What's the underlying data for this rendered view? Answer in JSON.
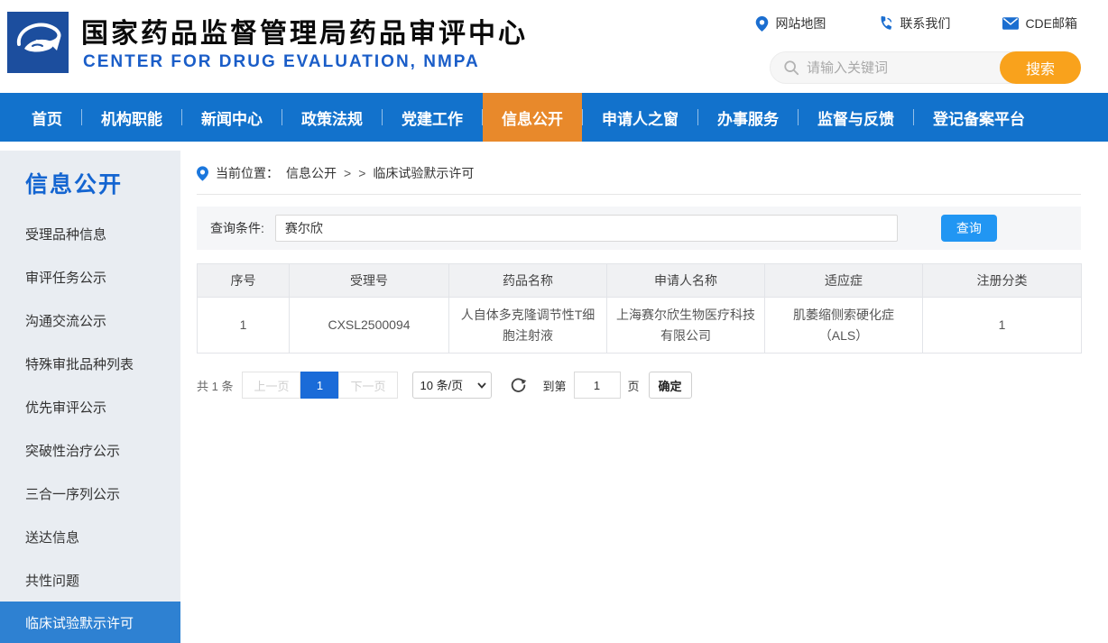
{
  "header": {
    "title": "国家药品监督管理局药品审评中心",
    "subtitle": "CENTER FOR DRUG EVALUATION, NMPA",
    "quick_links": [
      {
        "label": "网站地图",
        "icon": "location-pin-icon"
      },
      {
        "label": "联系我们",
        "icon": "phone-icon"
      },
      {
        "label": "CDE邮箱",
        "icon": "envelope-icon"
      }
    ],
    "search": {
      "placeholder": "请输入关键词",
      "button_label": "搜索"
    }
  },
  "nav": {
    "items": [
      {
        "label": "首页",
        "active": false
      },
      {
        "label": "机构职能",
        "active": false
      },
      {
        "label": "新闻中心",
        "active": false
      },
      {
        "label": "政策法规",
        "active": false
      },
      {
        "label": "党建工作",
        "active": false
      },
      {
        "label": "信息公开",
        "active": true
      },
      {
        "label": "申请人之窗",
        "active": false
      },
      {
        "label": "办事服务",
        "active": false
      },
      {
        "label": "监督与反馈",
        "active": false
      },
      {
        "label": "登记备案平台",
        "active": false
      }
    ]
  },
  "sidebar": {
    "title": "信息公开",
    "items": [
      {
        "label": "受理品种信息",
        "active": false
      },
      {
        "label": "审评任务公示",
        "active": false
      },
      {
        "label": "沟通交流公示",
        "active": false
      },
      {
        "label": "特殊审批品种列表",
        "active": false
      },
      {
        "label": "优先审评公示",
        "active": false
      },
      {
        "label": "突破性治疗公示",
        "active": false
      },
      {
        "label": "三合一序列公示",
        "active": false
      },
      {
        "label": "送达信息",
        "active": false
      },
      {
        "label": "共性问题",
        "active": false
      },
      {
        "label": "临床试验默示许可",
        "active": true
      }
    ]
  },
  "breadcrumb": {
    "prefix": "当前位置：",
    "section": "信息公开",
    "separator": ">",
    "current": "临床试验默示许可"
  },
  "query": {
    "label": "查询条件:",
    "value": "赛尔欣",
    "button_label": "查询"
  },
  "table": {
    "headers": [
      "序号",
      "受理号",
      "药品名称",
      "申请人名称",
      "适应症",
      "注册分类"
    ],
    "rows": [
      [
        "1",
        "CXSL2500094",
        "人自体多克隆调节性T细胞注射液",
        "上海赛尔欣生物医疗科技有限公司",
        "肌萎缩侧索硬化症（ALS）",
        "1"
      ]
    ]
  },
  "pagination": {
    "total": "共 1 条",
    "prev_label": "上一页",
    "current_page": "1",
    "next_label": "下一页",
    "page_size": "10 条/页",
    "goto_label": "到第",
    "goto_value": "1",
    "page_unit": "页",
    "confirm_label": "确定"
  },
  "colors": {
    "nav_blue": "#1272cc",
    "nav_active_orange": "#e8892b",
    "search_orange": "#f9a21c",
    "query_button_blue": "#2196f3",
    "sidebar_active_blue": "#2e81d2",
    "pagination_blue": "#1a6bd8",
    "logo_blue": "#1c4e9e",
    "subtitle_blue": "#1a5dc8"
  }
}
